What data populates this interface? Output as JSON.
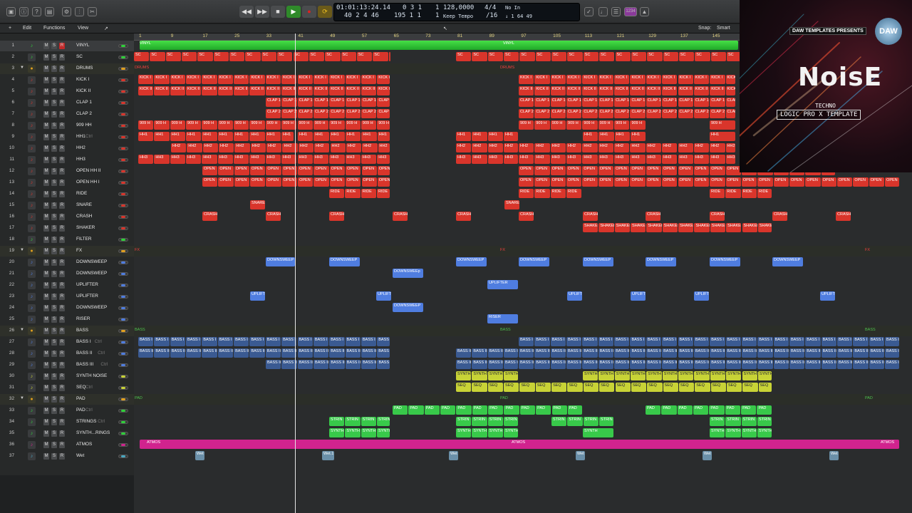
{
  "app": {
    "name": "Logic Pro X"
  },
  "lcd": {
    "time": "01:01:13:24.14",
    "bars": "40 2 4  46",
    "sub1": "0 3 1",
    "sub2": "195 1 1",
    "div1": "1",
    "div2": "1",
    "tempo": "128,0000",
    "tempo_mode": "Keep Tempo",
    "sig": "4/4",
    "div": "/16",
    "in": "No In",
    "out": "↓ 1 64 49"
  },
  "toolbar": {
    "edit": "Edit",
    "functions": "Functions",
    "view": "View",
    "snap_label": "Snap:",
    "snap_value": "Smart"
  },
  "topbar": {
    "badge": "1234"
  },
  "ruler": {
    "ticks": [
      "1",
      "9",
      "17",
      "25",
      "33",
      "41",
      "49",
      "57",
      "65",
      "73",
      "81",
      "89",
      "97",
      "105",
      "113",
      "121",
      "129",
      "137",
      "145"
    ]
  },
  "colors": {
    "red": "#d9352b",
    "blue": "#4f7de0",
    "green": "#2fd03a",
    "yellow": "#c8d336",
    "magenta": "#d1238e",
    "orange": "#e0a020",
    "teal": "#49a7c0"
  },
  "tracks": [
    {
      "num": "1",
      "name": "VINYL",
      "icon": "vinyl-icon",
      "color": "green"
    },
    {
      "num": "2",
      "name": "SC",
      "icon": "note-icon",
      "color": "green"
    },
    {
      "num": "3",
      "name": "DRUMS",
      "icon": "folder-icon",
      "color": "orange",
      "folder": true
    },
    {
      "num": "4",
      "name": "KICK I",
      "icon": "drum-icon",
      "color": "red"
    },
    {
      "num": "5",
      "name": "KICK II",
      "icon": "drum-icon",
      "color": "red"
    },
    {
      "num": "6",
      "name": "CLAP 1",
      "icon": "clap-icon",
      "color": "red"
    },
    {
      "num": "7",
      "name": "CLAP 2",
      "icon": "clap-icon",
      "color": "red"
    },
    {
      "num": "8",
      "name": "909 HH",
      "icon": "drum-machine-icon",
      "color": "red"
    },
    {
      "num": "9",
      "name": "HH1",
      "icon": "cymbal-icon",
      "color": "red",
      "sub": "Ctrl"
    },
    {
      "num": "10",
      "name": "HH2",
      "icon": "cymbal-icon",
      "color": "red"
    },
    {
      "num": "11",
      "name": "HH3",
      "icon": "cymbal-icon",
      "color": "red"
    },
    {
      "num": "12",
      "name": "OPEN HH II",
      "icon": "cymbal-icon",
      "color": "red"
    },
    {
      "num": "13",
      "name": "OPEN HH I",
      "icon": "cymbal-icon",
      "color": "red"
    },
    {
      "num": "14",
      "name": "RIDE",
      "icon": "cymbal-icon",
      "color": "red"
    },
    {
      "num": "15",
      "name": "SNARE",
      "icon": "snare-icon",
      "color": "red"
    },
    {
      "num": "16",
      "name": "CRASH",
      "icon": "cymbal-icon",
      "color": "red"
    },
    {
      "num": "17",
      "name": "SHAKER",
      "icon": "shaker-icon",
      "color": "red"
    },
    {
      "num": "18",
      "name": "FILTER",
      "icon": "filter-icon",
      "color": "green"
    },
    {
      "num": "19",
      "name": "FX",
      "icon": "folder-icon",
      "color": "orange",
      "folder": true
    },
    {
      "num": "20",
      "name": "DOWNSWEEP",
      "icon": "sparkle-icon",
      "color": "blue"
    },
    {
      "num": "21",
      "name": "DOWNSWEEP",
      "icon": "audio-icon",
      "color": "blue"
    },
    {
      "num": "22",
      "name": "UPLIFTER",
      "icon": "audio-icon",
      "color": "blue"
    },
    {
      "num": "23",
      "name": "UPLIFTER",
      "icon": "audio-icon",
      "color": "blue"
    },
    {
      "num": "24",
      "name": "DOWNSWEEP",
      "icon": "audio-icon",
      "color": "blue"
    },
    {
      "num": "25",
      "name": "RISER",
      "icon": "audio-icon",
      "color": "blue"
    },
    {
      "num": "26",
      "name": "BASS",
      "icon": "folder-icon",
      "color": "orange",
      "folder": true
    },
    {
      "num": "27",
      "name": "BASS I",
      "icon": "audio-icon",
      "color": "blue",
      "sub": "Ctrl"
    },
    {
      "num": "28",
      "name": "BASS II",
      "icon": "audio-icon",
      "color": "blue",
      "sub": "Ctrl"
    },
    {
      "num": "29",
      "name": "BASS III",
      "icon": "audio-icon",
      "color": "blue",
      "sub": "Ctrl"
    },
    {
      "num": "30",
      "name": "SYNTH NOISE",
      "icon": "audio-icon",
      "color": "yellow"
    },
    {
      "num": "31",
      "name": "SEQ",
      "icon": "audio-icon",
      "color": "yellow",
      "sub": "Ctrl"
    },
    {
      "num": "32",
      "name": "PAD",
      "icon": "folder-icon",
      "color": "orange",
      "folder": true
    },
    {
      "num": "33",
      "name": "PAD",
      "icon": "audio-icon",
      "color": "green",
      "sub": "Ctrl"
    },
    {
      "num": "34",
      "name": "STRINGS",
      "icon": "strings-icon",
      "color": "green",
      "sub": "Ctrl"
    },
    {
      "num": "35",
      "name": "SYNTH...RINGS",
      "icon": "strings-icon",
      "color": "green"
    },
    {
      "num": "36",
      "name": "ATMOS",
      "icon": "audio-icon",
      "color": "magenta"
    },
    {
      "num": "37",
      "name": "Wet",
      "icon": "mic-icon",
      "color": "teal"
    }
  ],
  "lanes": [
    {
      "color": "green",
      "full": true,
      "labels": [
        "VINYL",
        "VINYL"
      ],
      "label_at": [
        0,
        510
      ]
    },
    {
      "color": "red",
      "alt": "sc",
      "segs": [
        [
          0,
          360,
          "SC"
        ],
        [
          452,
          852,
          "SC"
        ]
      ]
    },
    {
      "folder": true,
      "labels": [
        "DRUMS",
        "DRUMS"
      ],
      "label_at": [
        0,
        513
      ]
    },
    {
      "color": "red",
      "segs": [
        [
          6,
          360,
          "KICK I"
        ],
        [
          540,
          845,
          "KICK I"
        ]
      ]
    },
    {
      "color": "red",
      "segs": [
        [
          6,
          360,
          "KICK II"
        ],
        [
          540,
          845,
          "KICK II"
        ]
      ]
    },
    {
      "color": "red",
      "segs": [
        [
          185,
          360,
          "CLAP 1"
        ],
        [
          540,
          845,
          "CLAP 1"
        ]
      ]
    },
    {
      "color": "red",
      "segs": [
        [
          185,
          360,
          "CLAP 2"
        ],
        [
          540,
          845,
          "CLAP 2"
        ]
      ]
    },
    {
      "color": "red",
      "segs": [
        [
          6,
          360,
          "909 H"
        ],
        [
          540,
          720,
          "909 H"
        ],
        [
          808,
          845,
          "909 H"
        ]
      ]
    },
    {
      "color": "red",
      "segs": [
        [
          6,
          225,
          "HH1"
        ],
        [
          230,
          360,
          "HH1"
        ],
        [
          452,
          540,
          "HH1"
        ],
        [
          630,
          720,
          "HH1"
        ],
        [
          808,
          845,
          "HH1"
        ]
      ]
    },
    {
      "color": "red",
      "segs": [
        [
          52,
          360,
          "HH2"
        ],
        [
          452,
          540,
          "HH2"
        ],
        [
          540,
          845,
          "HH2"
        ]
      ]
    },
    {
      "color": "red",
      "segs": [
        [
          6,
          360,
          "HH3"
        ],
        [
          452,
          540,
          "HH3"
        ],
        [
          540,
          845,
          "HH3"
        ]
      ]
    },
    {
      "color": "red",
      "segs": [
        [
          96,
          360,
          "OPEN"
        ],
        [
          540,
          985,
          "OPEN"
        ]
      ]
    },
    {
      "color": "red",
      "segs": [
        [
          96,
          360,
          "OPEN"
        ],
        [
          540,
          1075,
          "OPEN"
        ]
      ]
    },
    {
      "color": "red",
      "segs": [
        [
          274,
          360,
          "RIDE"
        ],
        [
          540,
          630,
          "RIDE"
        ],
        [
          808,
          896,
          "RIDE"
        ]
      ]
    },
    {
      "color": "red",
      "segs": [
        [
          163,
          185,
          "SNARE"
        ],
        [
          520,
          542,
          "SNARE"
        ]
      ]
    },
    {
      "color": "red",
      "segs": [
        [
          96,
          118,
          "CRASH"
        ],
        [
          185,
          207,
          "CRASH"
        ],
        [
          274,
          296,
          "CRASH"
        ],
        [
          363,
          385,
          "CRASH"
        ],
        [
          452,
          474,
          "CRASH"
        ],
        [
          540,
          562,
          "CRASH"
        ],
        [
          630,
          652,
          "CRASH"
        ],
        [
          718,
          740,
          "CRASH"
        ],
        [
          808,
          830,
          "CRASH"
        ],
        [
          896,
          918,
          "CRASH"
        ],
        [
          985,
          1007,
          "CRASH"
        ]
      ]
    },
    {
      "color": "red",
      "segs": [
        [
          630,
          896,
          "SHAKER"
        ]
      ]
    },
    {
      "color": "none",
      "segs": []
    },
    {
      "folder": true,
      "labels": [
        "FX",
        "FX",
        "FX"
      ],
      "label_at": [
        0,
        513,
        1025
      ]
    },
    {
      "color": "blue",
      "segs": [
        [
          185,
          227,
          "DOWNSWEEP"
        ],
        [
          274,
          318,
          "DOWNSWEEP"
        ],
        [
          452,
          496,
          "DOWNSWEEP"
        ],
        [
          540,
          584,
          "DOWNSWEEP"
        ],
        [
          630,
          674,
          "DOWNSWEEP"
        ],
        [
          718,
          762,
          "DOWNSWEEP"
        ],
        [
          808,
          852,
          "DOWNSWEEP"
        ],
        [
          896,
          940,
          "DOWNSWEEP"
        ]
      ]
    },
    {
      "color": "blue",
      "segs": [
        [
          363,
          407,
          "DOWNSWEEp"
        ]
      ]
    },
    {
      "color": "blue",
      "segs": [
        [
          496,
          540,
          "UPLIFTER"
        ]
      ]
    },
    {
      "color": "blue",
      "segs": [
        [
          163,
          185,
          "UPLIFT"
        ],
        [
          340,
          362,
          "UPLIFT"
        ],
        [
          608,
          630,
          "UPLIFT"
        ],
        [
          697,
          719,
          "UPLIFT"
        ],
        [
          786,
          808,
          "UPLIFT"
        ],
        [
          963,
          985,
          "UPLIFT"
        ]
      ]
    },
    {
      "color": "blue",
      "segs": [
        [
          363,
          407,
          "DOWNSWEEP"
        ]
      ]
    },
    {
      "color": "blue",
      "segs": [
        [
          496,
          540,
          "RISER"
        ]
      ]
    },
    {
      "folder": true,
      "labels": [
        "BASS",
        "BASS",
        "BASS"
      ],
      "label_at": [
        0,
        513,
        1025
      ]
    },
    {
      "color": "blue",
      "segs": [
        [
          6,
          360,
          "BASS I"
        ],
        [
          540,
          1075,
          "BASS I"
        ]
      ]
    },
    {
      "color": "blue",
      "segs": [
        [
          6,
          360,
          "BASS II"
        ],
        [
          452,
          540,
          "BASS II"
        ],
        [
          540,
          1075,
          "BASS II"
        ]
      ]
    },
    {
      "color": "blue",
      "segs": [
        [
          185,
          360,
          "BASS II"
        ],
        [
          452,
          540,
          "BASS III"
        ],
        [
          540,
          1075,
          "BASS II"
        ]
      ]
    },
    {
      "color": "yellow",
      "segs": [
        [
          452,
          540,
          "SYNTH"
        ],
        [
          630,
          896,
          "SYNTH"
        ]
      ]
    },
    {
      "color": "yellow",
      "segs": [
        [
          452,
          896,
          "SEQ"
        ]
      ]
    },
    {
      "folder": true,
      "labels": [
        "PAD",
        "PAD",
        "PAD"
      ],
      "label_at": [
        0,
        513,
        1025
      ]
    },
    {
      "color": "green",
      "segs": [
        [
          363,
          630,
          "PAD"
        ],
        [
          718,
          896,
          "PAD"
        ]
      ]
    },
    {
      "color": "green",
      "segs": [
        [
          274,
          360,
          "STRIN"
        ],
        [
          452,
          540,
          "STRIN"
        ],
        [
          586,
          674,
          "STRIN"
        ],
        [
          808,
          896,
          "STRIN"
        ]
      ]
    },
    {
      "color": "green",
      "segs": [
        [
          274,
          360,
          "SYNTH"
        ],
        [
          452,
          540,
          "SYNTH"
        ],
        [
          630,
          674,
          "SYNTH"
        ],
        [
          808,
          896,
          "SYNTH"
        ]
      ]
    },
    {
      "color": "magenta",
      "full": true,
      "labels": [
        "ATMOS",
        "ATMOS",
        "ATMOS"
      ],
      "label_at": [
        10,
        522,
        1040
      ]
    },
    {
      "color": "teal",
      "segs": [
        [
          86,
          100,
          "Wet"
        ],
        [
          264,
          282,
          "Wet.1"
        ],
        [
          442,
          456,
          "Wet"
        ],
        [
          620,
          634,
          "Wet"
        ],
        [
          798,
          812,
          "Wet"
        ],
        [
          976,
          990,
          "Wet"
        ]
      ]
    }
  ],
  "banner": {
    "presents": "DAW TEMPLATES PRESENTS",
    "logo": "DAW",
    "title": "NoisE",
    "genre": "TECHNO",
    "template": "LOGIC PRO X TEMPLATE"
  }
}
